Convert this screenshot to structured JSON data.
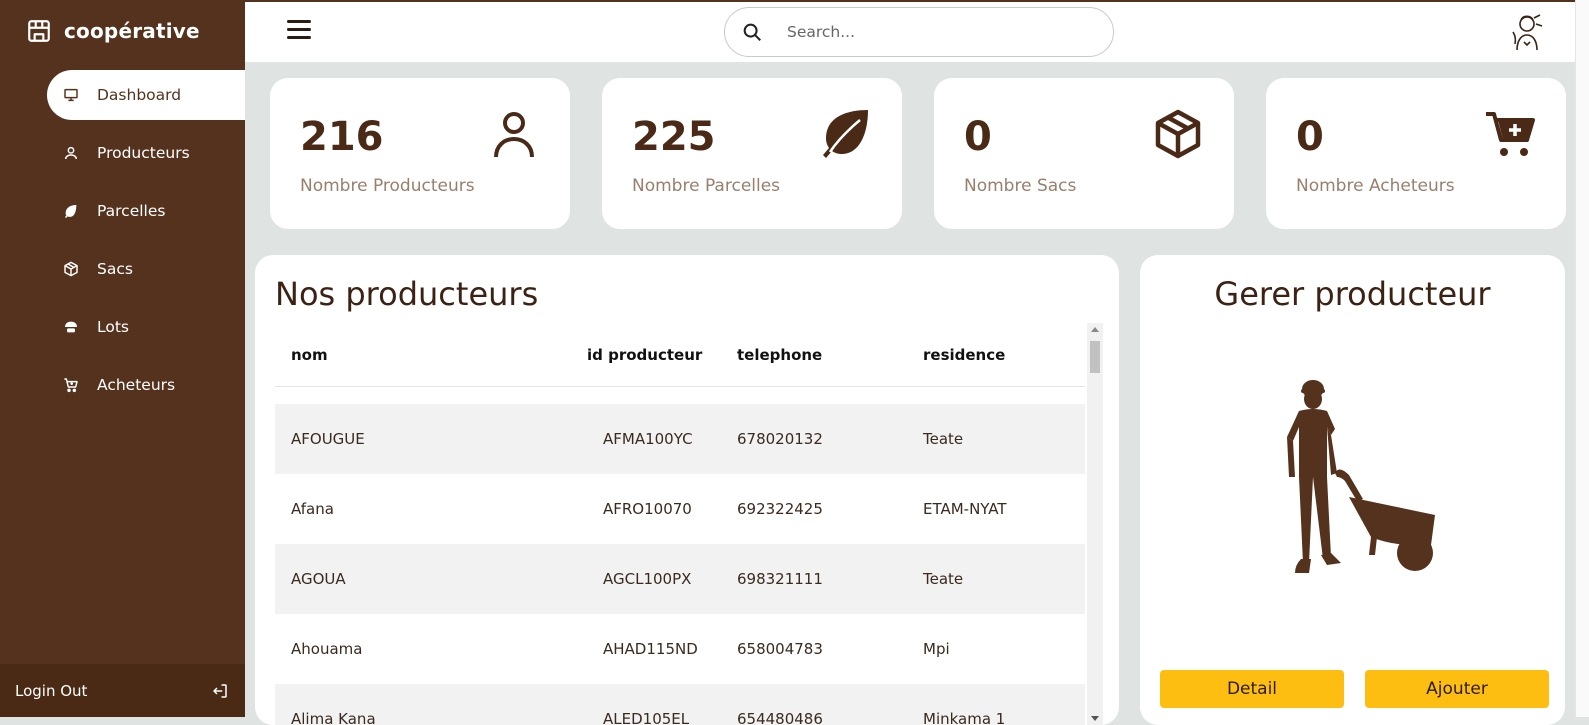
{
  "brand": {
    "name": "coopérative",
    "icon": "store-icon"
  },
  "sidebar": {
    "items": [
      {
        "label": "Dashboard",
        "icon": "monitor-icon",
        "active": true
      },
      {
        "label": "Producteurs",
        "icon": "user-icon",
        "active": false
      },
      {
        "label": "Parcelles",
        "icon": "leaf-icon",
        "active": false
      },
      {
        "label": "Sacs",
        "icon": "box-icon",
        "active": false
      },
      {
        "label": "Lots",
        "icon": "bowl-icon",
        "active": false
      },
      {
        "label": "Acheteurs",
        "icon": "cart-icon",
        "active": false
      }
    ],
    "logout_label": "Login Out"
  },
  "search": {
    "placeholder": "Search...",
    "value": ""
  },
  "stats": [
    {
      "value": "216",
      "label": "Nombre Producteurs",
      "icon": "user-icon"
    },
    {
      "value": "225",
      "label": "Nombre Parcelles",
      "icon": "leaf-icon"
    },
    {
      "value": "0",
      "label": "Nombre Sacs",
      "icon": "box-icon"
    },
    {
      "value": "0",
      "label": "Nombre Acheteurs",
      "icon": "cart-plus-icon"
    }
  ],
  "producers": {
    "title": "Nos producteurs",
    "columns": [
      "nom",
      "id producteur",
      "telephone",
      "residence"
    ],
    "rows": [
      [
        "AFOUGUE",
        "AFMA100YC",
        "678020132",
        "Teate"
      ],
      [
        "Afana",
        "AFRO10070",
        "692322425",
        "ETAM-NYAT"
      ],
      [
        "AGOUA",
        "AGCL100PX",
        "698321111",
        "Teate"
      ],
      [
        "Ahouama",
        "AHAD115ND",
        "658004783",
        "Mpi"
      ],
      [
        "Alima Kana",
        "ALED105EL",
        "654480486",
        "Minkama 1"
      ]
    ]
  },
  "manage": {
    "title": "Gerer producteur",
    "detail_label": "Detail",
    "add_label": "Ajouter"
  },
  "colors": {
    "sidebar": "#55321d",
    "accent_button": "#fdbe11",
    "text_brown": "#4a2a17"
  }
}
